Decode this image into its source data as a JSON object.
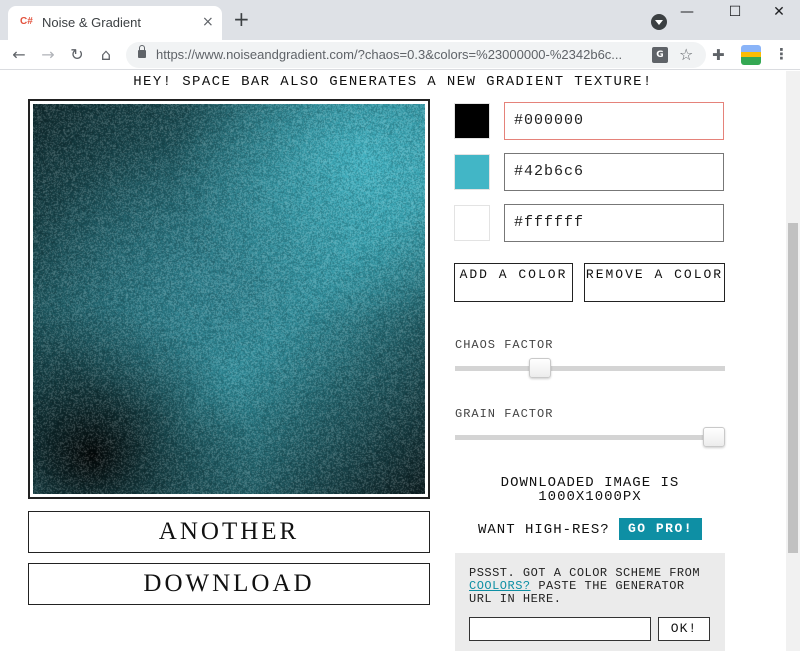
{
  "browser": {
    "tab_favicon": "C#",
    "tab_title": "Noise & Gradient",
    "tab_close": "×",
    "new_tab": "+",
    "url": "https://www.noiseandgradient.com/?chaos=0.3&colors=%23000000-%2342b6c...",
    "window_controls": {
      "minimize": "—",
      "maximize": "☐",
      "close": "✕"
    },
    "nav": {
      "back": "←",
      "forward": "→",
      "reload": "↻",
      "home": "⌂"
    },
    "icons": {
      "translate": "G",
      "star": "☆",
      "extensions": "✚",
      "menu": "⋮"
    }
  },
  "page": {
    "hint": "HEY! SPACE BAR ALSO GENERATES A NEW GRADIENT TEXTURE!",
    "colors": [
      {
        "hex": "#000000",
        "swatch": "#000000"
      },
      {
        "hex": "#42b6c6",
        "swatch": "#42b6c6"
      },
      {
        "hex": "#ffffff",
        "swatch": "#ffffff"
      }
    ],
    "add_color_label": "ADD A COLOR",
    "remove_color_label": "REMOVE A COLOR",
    "chaos": {
      "label": "CHAOS FACTOR",
      "value": 0.3
    },
    "grain": {
      "label": "GRAIN FACTOR",
      "value": 1.0
    },
    "another_label": "ANOTHER",
    "download_label": "DOWNLOAD",
    "download_info_line1": "DOWNLOADED IMAGE IS",
    "download_info_line2": "1000X1000PX",
    "highres_label": "WANT HIGH-RES?",
    "gopro_label": "GO PRO!",
    "coolors_text_before": "PSSST. GOT A COLOR SCHEME FROM",
    "coolors_link": "COOLORS?",
    "coolors_text_after": "PASTE THE GENERATOR URL IN HERE.",
    "coolors_input_value": "",
    "ok_label": "OK!"
  }
}
